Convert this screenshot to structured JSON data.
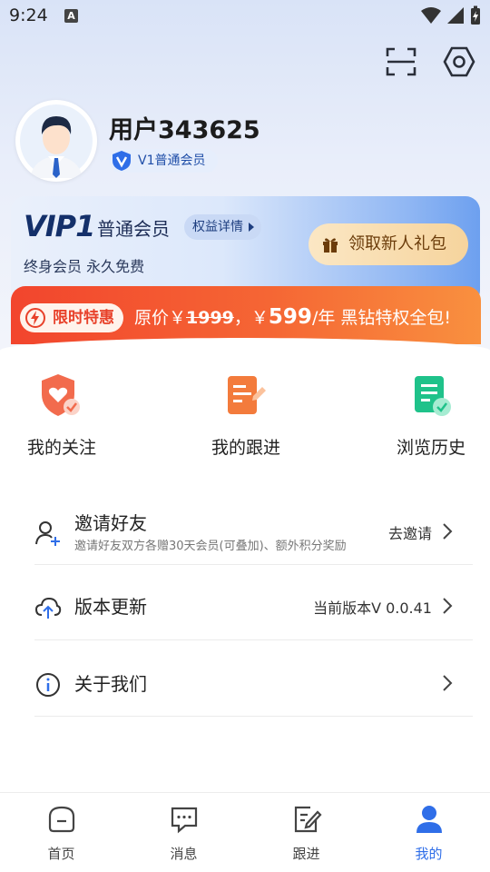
{
  "status_bar": {
    "time": "9:24",
    "notification_letter": "A"
  },
  "profile": {
    "username": "用户343625",
    "member_badge": "V1普通会员"
  },
  "vip_card": {
    "logo": "VIP1",
    "level": "普通会员",
    "rights_button": "权益详情",
    "subtitle": "终身会员 永久免费",
    "gift_button": "领取新人礼包"
  },
  "promo": {
    "tag": "限时特惠",
    "prefix": "原价￥",
    "original_price": "1999",
    "middle": "，￥",
    "sale_price": "599",
    "suffix": "/年 黑钻特权全包!"
  },
  "quick_actions": [
    {
      "label": "我的关注"
    },
    {
      "label": "我的跟进"
    },
    {
      "label": "浏览历史"
    }
  ],
  "menu": {
    "invite": {
      "title": "邀请好友",
      "desc": "邀请好友双方各赠30天会员(可叠加)、额外积分奖励",
      "action": "去邀请"
    },
    "update": {
      "title": "版本更新",
      "version": "当前版本V 0.0.41"
    },
    "about": {
      "title": "关于我们"
    }
  },
  "bottom_nav": [
    {
      "label": "首页"
    },
    {
      "label": "消息"
    },
    {
      "label": "跟进"
    },
    {
      "label": "我的"
    }
  ],
  "colors": {
    "accent": "#2f6ee8",
    "promo": "#f2452d",
    "gift": "#f6d49d"
  }
}
